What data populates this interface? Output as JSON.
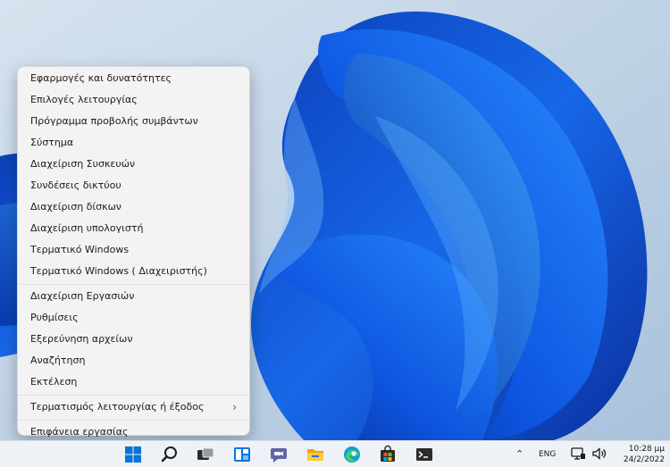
{
  "menu": {
    "items": [
      {
        "label": "Εφαρμογές και δυνατότητες"
      },
      {
        "label": "Επιλογές λειτουργίας"
      },
      {
        "label": "Πρόγραμμα προβολής συμβάντων"
      },
      {
        "label": "Σύστημα"
      },
      {
        "label": "Διαχείριση Συσκευών"
      },
      {
        "label": "Συνδέσεις δικτύου"
      },
      {
        "label": "Διαχείριση δίσκων"
      },
      {
        "label": "Διαχείριση υπολογιστή"
      },
      {
        "label": "Τερματικό Windows"
      },
      {
        "label": "Τερματικό Windows ( Διαχειριστής)"
      },
      {
        "label": "Διαχείριση Εργασιών"
      },
      {
        "label": "Ρυθμίσεις"
      },
      {
        "label": "Εξερεύνηση αρχείων"
      },
      {
        "label": "Αναζήτηση"
      },
      {
        "label": "Εκτέλεση"
      },
      {
        "label": "Τερματισμός λειτουργίας ή έξοδος",
        "submenu": true
      },
      {
        "label": "Επιφάνεια εργασίας"
      }
    ],
    "chevron": "›"
  },
  "taskbar": {
    "icons": [
      "windows-start-icon",
      "search-icon",
      "task-view-icon",
      "widgets-icon",
      "teams-chat-icon",
      "file-explorer-icon",
      "edge-icon",
      "store-icon",
      "terminal-icon"
    ],
    "tray": {
      "chevron": "⌃",
      "language": "ENG",
      "time": "10:28 μμ",
      "date": "24/2/2022"
    }
  },
  "colors": {
    "accent": "#0078d4",
    "taskbar_bg": "#eef1f5",
    "menu_bg": "#f3f3f3",
    "wallpaper_bg": "#c5d6e8",
    "bloom_blue": "#0a4fd8"
  }
}
